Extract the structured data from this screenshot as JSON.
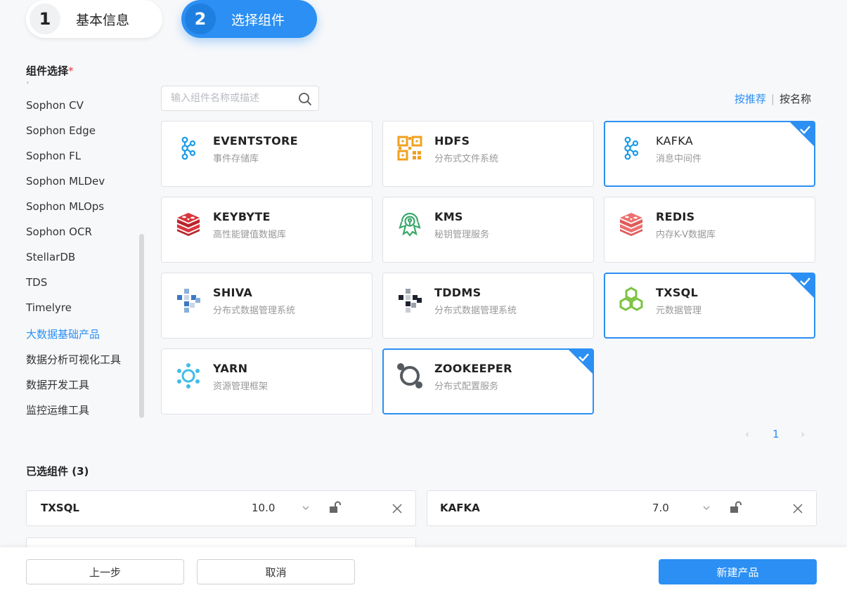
{
  "steps": [
    {
      "num": "1",
      "label": "基本信息",
      "active": false
    },
    {
      "num": "2",
      "label": "选择组件",
      "active": true
    }
  ],
  "component_select": {
    "title": "组件选择",
    "required_mark": "*"
  },
  "sidebar": {
    "partial_item": "·",
    "items": [
      "Sophon CV",
      "Sophon Edge",
      "Sophon FL",
      "Sophon MLDev",
      "Sophon MLOps",
      "Sophon OCR",
      "StellarDB",
      "TDS",
      "Timelyre",
      "大数据基础产品",
      "数据分析可视化工具",
      "数据开发工具",
      "监控运维工具"
    ],
    "active_index": 9
  },
  "search": {
    "placeholder": "输入组件名称或描述",
    "value": ""
  },
  "sort": {
    "recommended": "按推荐",
    "separator": "|",
    "by_name": "按名称"
  },
  "cards": [
    {
      "title": "EVENTSTORE",
      "desc": "事件存储库",
      "icon": "kafka-icon",
      "selected": false
    },
    {
      "title": "HDFS",
      "desc": "分布式文件系统",
      "icon": "hdfs-icon",
      "selected": false
    },
    {
      "title": "KAFKA",
      "desc": "消息中间件",
      "icon": "kafka-icon",
      "selected": true
    },
    {
      "title": "KEYBYTE",
      "desc": "高性能键值数据库",
      "icon": "redis-icon",
      "selected": false
    },
    {
      "title": "KMS",
      "desc": "秘钥管理服务",
      "icon": "kms-icon",
      "selected": false
    },
    {
      "title": "REDIS",
      "desc": "内存K-V数据库",
      "icon": "redis-icon",
      "selected": false
    },
    {
      "title": "SHIVA",
      "desc": "分布式数据管理系统",
      "icon": "shiva-icon",
      "selected": false
    },
    {
      "title": "TDDMS",
      "desc": "分布式数据管理系统",
      "icon": "tddms-icon",
      "selected": false
    },
    {
      "title": "TXSQL",
      "desc": "元数据管理",
      "icon": "txsql-icon",
      "selected": true
    },
    {
      "title": "YARN",
      "desc": "资源管理框架",
      "icon": "yarn-icon",
      "selected": false
    },
    {
      "title": "ZOOKEEPER",
      "desc": "分布式配置服务",
      "icon": "zookeeper-icon",
      "selected": true
    }
  ],
  "pagination": {
    "prev": "‹",
    "page": "1",
    "next": "›"
  },
  "selected_section": {
    "title": "已选组件 (3)"
  },
  "selected": [
    {
      "name": "TXSQL",
      "version": "10.0"
    },
    {
      "name": "KAFKA",
      "version": "7.0"
    }
  ],
  "footer": {
    "prev": "上一步",
    "cancel": "取消",
    "create": "新建产品"
  },
  "colors": {
    "accent": "#2b8ff3",
    "kafka": "#1c9be6",
    "hdfs": "#f0a020",
    "redis": "#d9363e",
    "redis_light": "#f06e6e",
    "kms": "#3aa86b",
    "txsql": "#7cc242",
    "yarn": "#3fbde8",
    "zookeeper": "#555a60"
  }
}
